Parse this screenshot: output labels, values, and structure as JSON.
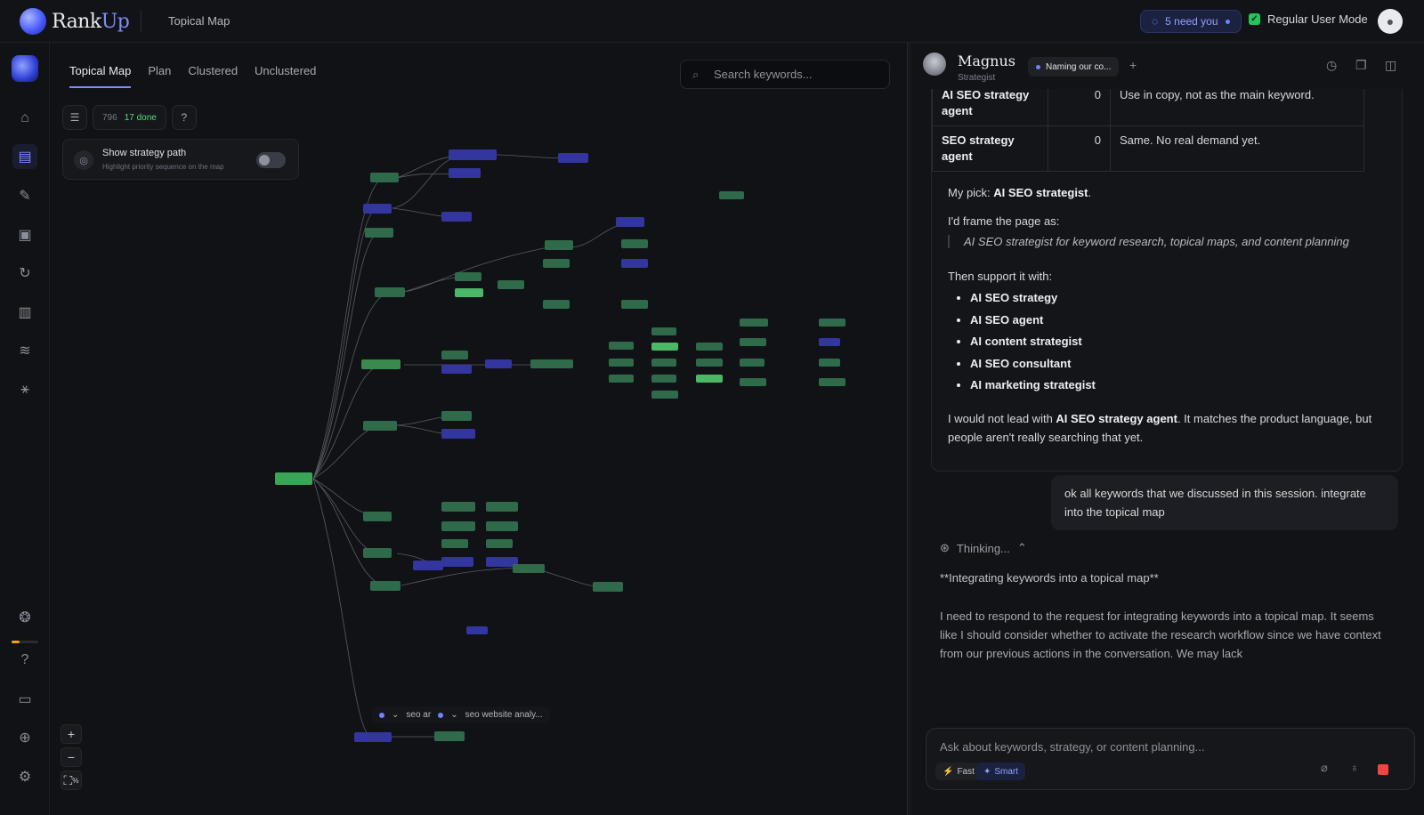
{
  "app": {
    "brand_main": "Rank",
    "brand_accent": "Up",
    "page_title": "Topical Map"
  },
  "topbar": {
    "need_you": "5 need you",
    "user_mode": "Regular User Mode"
  },
  "nav": {
    "items": [
      "home-icon",
      "map-icon",
      "document-icon",
      "clipboard-icon",
      "refresh-icon",
      "chart-icon",
      "database-icon",
      "network-icon"
    ],
    "bottom": [
      "pulse-icon",
      "help-icon",
      "chat-icon",
      "add-user-icon",
      "settings-icon"
    ]
  },
  "map": {
    "tabs": [
      "Topical Map",
      "Plan",
      "Clustered",
      "Unclustered"
    ],
    "active_tab": "Topical Map",
    "search_placeholder": "Search keywords...",
    "count_total": "796",
    "count_done": "17 done",
    "strategy_title": "Show strategy path",
    "strategy_sub": "Highlight priority sequence on the map",
    "legend_a": "seo ar",
    "legend_b": "seo website analy...",
    "zoom_in": "+",
    "zoom_out": "−",
    "fit_label": "%"
  },
  "chat": {
    "agent_name": "Magnus",
    "agent_role": "Strategist",
    "conversation": "Naming our co...",
    "table": [
      {
        "keyword": "AI SEO strategy agent",
        "volume": "0",
        "note": "Use in copy, not as the main keyword."
      },
      {
        "keyword": "SEO strategy agent",
        "volume": "0",
        "note": "Same. No real demand yet."
      }
    ],
    "pick_prefix": "My pick: ",
    "pick_value": "AI SEO strategist",
    "pick_suffix": ".",
    "frame_intro": "I'd frame the page as:",
    "frame_quote": "AI SEO strategist for keyword research, topical maps, and content planning",
    "support_intro": "Then support it with:",
    "support_list": [
      "AI SEO strategy",
      "AI SEO agent",
      "AI content strategist",
      "AI SEO consultant",
      "AI marketing strategist"
    ],
    "closing_a": "I would not lead with ",
    "closing_b": "AI SEO strategy agent",
    "closing_c": ". It matches the product language, but people aren't really searching that yet.",
    "user_message": "ok all keywords that we discussed in this session. integrate into the topical map",
    "thinking_label": "Thinking...",
    "thinking_title": "**Integrating keywords into a topical map**",
    "thinking_body": "I need to respond to the request for integrating keywords into a topical map. It seems like I should consider whether to activate the research workflow since we have context from our previous actions in the conversation. We may lack",
    "composer_placeholder": "Ask about keywords, strategy, or content planning...",
    "mode_fast": "Fast",
    "mode_smart": "Smart"
  },
  "colors": {
    "accent": "#7b8cff",
    "green_node": "#2f6b4a",
    "blue_node": "#3436a0",
    "done": "#4ade80",
    "stop": "#ef4444"
  }
}
